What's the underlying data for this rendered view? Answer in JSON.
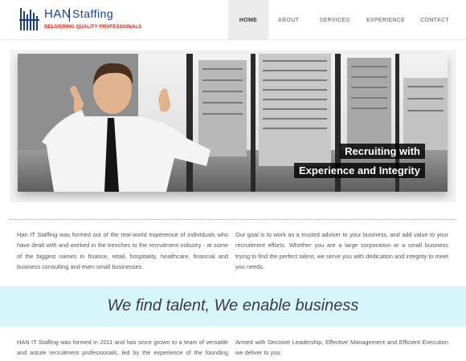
{
  "header": {
    "logo": {
      "name_han": "HAN",
      "name_staffing": "Staffing",
      "tagline": "DELIVERING QUALITY PROFESSIONALS"
    },
    "nav": [
      {
        "label": "HOME",
        "active": true
      },
      {
        "label": "ABOUT",
        "active": false
      },
      {
        "label": "SERVICES",
        "active": false
      },
      {
        "label": "EXPERIENCE",
        "active": false
      },
      {
        "label": "CONTACT",
        "active": false
      }
    ]
  },
  "hero": {
    "caption_line1": "Recruiting with",
    "caption_line2": "Experience and Integrity"
  },
  "intro": {
    "left": "Han IT Staffing was formed out of the real-world experience of individuals who have dealt with and worked in the trenches to the recruitment industry - at some of the biggest names in finance, retail, hospitality, healthcare, financial and business consulting and even small businesses.",
    "right": "Our goal is to work as a trusted adviser to your business, and add value to your recruitment efforts. Whether you are a large corporation or a small business trying to find the perfect talent, we serve you with dedication and integrity to meet you needs."
  },
  "band": {
    "text": "We find talent, We enable business"
  },
  "about": {
    "left": "HAN IT Staffing was formed in 2011 and has since grown to a team of versatile and astute recruitment professionals, led by the experience of the founding team. Our recruitment practices are simple and effective - and built around the",
    "right": "Armed with Decisive Leadership, Effective Management and Efficient Execution we deliver to you:"
  },
  "colors": {
    "brand_blue": "#1c3f8a",
    "brand_red": "#d0241b",
    "band_bg": "#d6f6f9"
  }
}
